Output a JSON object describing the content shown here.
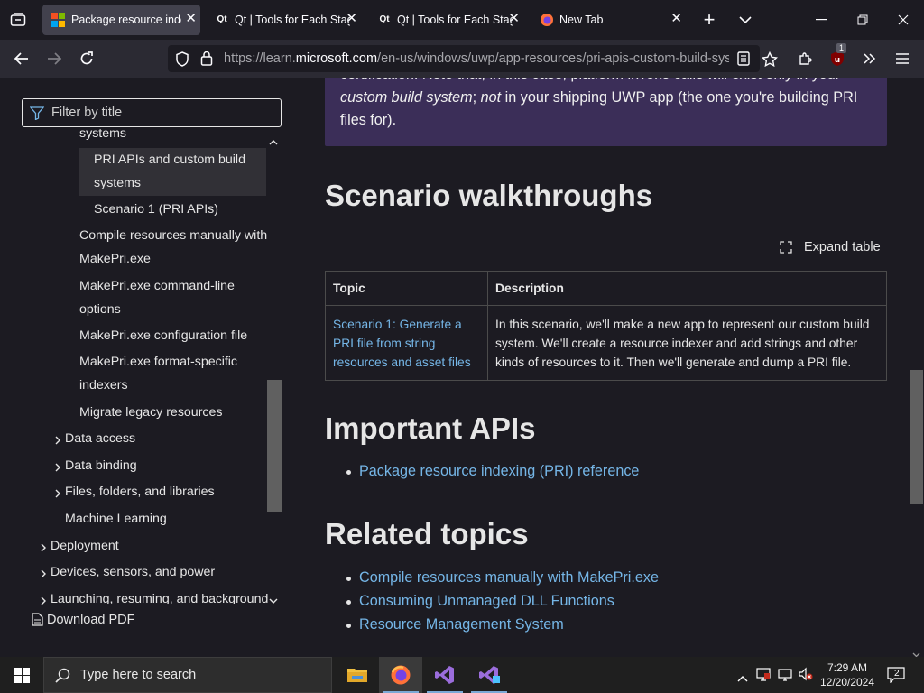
{
  "browser": {
    "tabs": [
      {
        "title": "Package resource indexing",
        "active": true
      },
      {
        "title": "Qt | Tools for Each Stage",
        "active": false
      },
      {
        "title": "Qt | Tools for Each Stage",
        "active": false
      },
      {
        "title": "New Tab",
        "active": false
      }
    ],
    "url_prefix": "https://learn.",
    "url_domain": "microsoft.com",
    "url_suffix": "/en-us/windows/uwp/app-resources/pri-apis-custom-build-syste",
    "extension_badge": "1"
  },
  "sidebar": {
    "filter_placeholder": "Filter by title",
    "items": [
      {
        "label": "systems"
      },
      {
        "label_line1": "PRI APIs and custom build",
        "label_line2": "systems",
        "selected": true
      },
      {
        "label": "Scenario 1 (PRI APIs)"
      },
      {
        "label_line1": "Compile resources manually with",
        "label_line2": "MakePri.exe"
      },
      {
        "label_line1": "MakePri.exe command-line",
        "label_line2": "options"
      },
      {
        "label": "MakePri.exe configuration file"
      },
      {
        "label_line1": "MakePri.exe format-specific",
        "label_line2": "indexers"
      },
      {
        "label": "Migrate legacy resources"
      },
      {
        "label": "Data access",
        "expandable": true
      },
      {
        "label": "Data binding",
        "expandable": true
      },
      {
        "label": "Files, folders, and libraries",
        "expandable": true
      },
      {
        "label": "Machine Learning"
      },
      {
        "label": "Deployment",
        "expandable": true
      },
      {
        "label": "Devices, sensors, and power",
        "expandable": true
      },
      {
        "label": "Launching, resuming, and background",
        "expandable": true
      }
    ],
    "download_pdf": "Download PDF"
  },
  "main": {
    "note": {
      "line1": "certification. Note that, in this case, platform invoke calls will exist only in your",
      "line2_italic": "custom build system",
      "line2_sep": "; ",
      "line2_not": "not",
      "line2_rest": " in your shipping UWP app (the one you're building PRI",
      "line3": "files for)."
    },
    "scenario_heading": "Scenario walkthroughs",
    "expand_table": "Expand table",
    "table": {
      "headers": [
        "Topic",
        "Description"
      ],
      "rows": [
        {
          "topic": "Scenario 1: Generate a PRI file from string resources and asset files",
          "description": "In this scenario, we'll make a new app to represent our custom build system. We'll create a resource indexer and add strings and other kinds of resources to it. Then we'll generate and dump a PRI file."
        }
      ]
    },
    "apis_heading": "Important APIs",
    "apis_links": [
      "Package resource indexing (PRI) reference"
    ],
    "related_heading": "Related topics",
    "related_links": [
      "Compile resources manually with MakePri.exe",
      "Consuming Unmanaged DLL Functions",
      "Resource Management System"
    ]
  },
  "taskbar": {
    "search_placeholder": "Type here to search",
    "time": "7:29 AM",
    "date": "12/20/2024",
    "notification_count": "2"
  }
}
